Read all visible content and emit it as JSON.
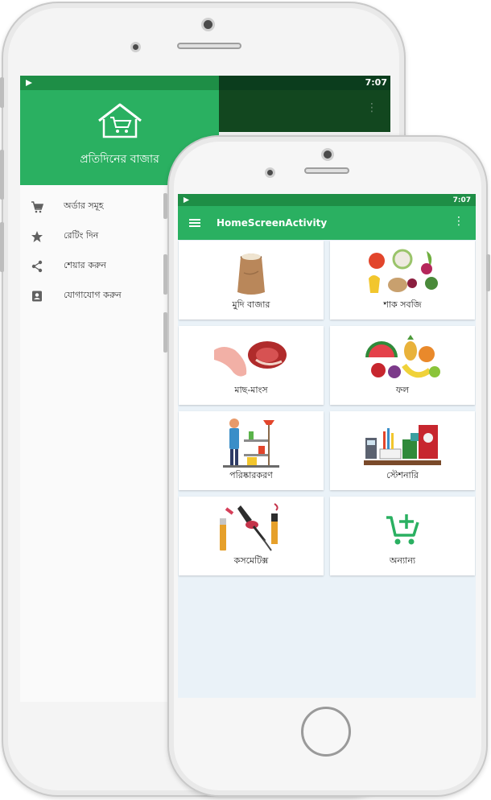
{
  "back_phone": {
    "status_time": "7:07",
    "drawer": {
      "title": "প্রতিদিনের বাজার",
      "items": [
        {
          "icon": "cart-icon",
          "label": "অর্ডার সমূহ"
        },
        {
          "icon": "star-icon",
          "label": "রেটিং দিন"
        },
        {
          "icon": "share-icon",
          "label": "শেয়ার করুন"
        },
        {
          "icon": "contact-icon",
          "label": "যোগাযোগ করুন"
        }
      ]
    }
  },
  "front_phone": {
    "status_time": "7:07",
    "app_title": "HomeScreenActivity",
    "categories": [
      {
        "label": "মুদি বাজার",
        "icon": "grocery-sack-icon"
      },
      {
        "label": "শাক সবজি",
        "icon": "vegetables-icon"
      },
      {
        "label": "মাছ-মাংস",
        "icon": "meat-icon"
      },
      {
        "label": "ফল",
        "icon": "fruits-icon"
      },
      {
        "label": "পরিষ্কারকরণ",
        "icon": "cleaning-icon"
      },
      {
        "label": "স্টেশনারি",
        "icon": "stationery-icon"
      },
      {
        "label": "কসমেটিক্স",
        "icon": "cosmetics-icon"
      },
      {
        "label": "অন্যান্য",
        "icon": "add-cart-icon"
      }
    ]
  },
  "colors": {
    "primary": "#2ab061",
    "status_bar": "#1e8e46"
  }
}
